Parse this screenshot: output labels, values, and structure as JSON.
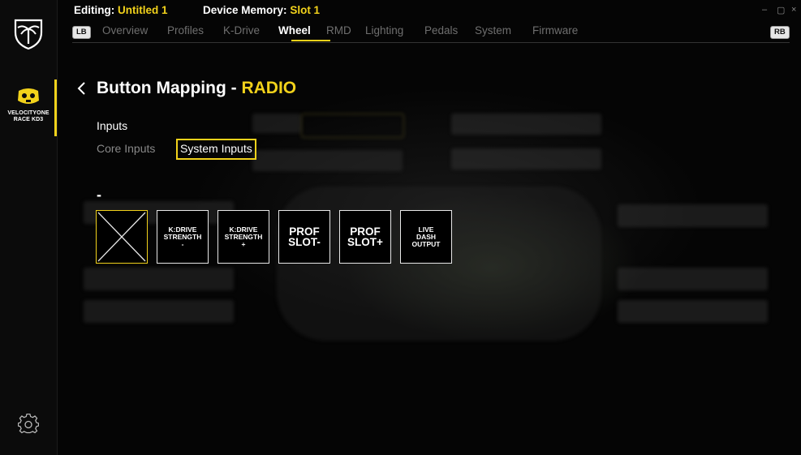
{
  "header": {
    "editing_label": "Editing:",
    "editing_value": "Untitled 1",
    "memory_label": "Device Memory:",
    "memory_value": "Slot 1"
  },
  "window_controls": [
    "–",
    "▢",
    "×"
  ],
  "tabs": {
    "left_key": "LB",
    "right_key": "RB",
    "items": [
      "Overview",
      "Profiles",
      "K-Drive",
      "Wheel",
      "RMD",
      "Lighting",
      "Pedals",
      "System",
      "Firmware"
    ],
    "active": "Wheel"
  },
  "sidebar": {
    "device_name_line1": "VELOCITYONE",
    "device_name_line2": "RACE KD3"
  },
  "page": {
    "title_prefix": "Button Mapping - ",
    "title_accent": "RADIO",
    "section_label": "Inputs",
    "subtab_core": "Core Inputs",
    "subtab_system": "System Inputs",
    "current_mapping": "-"
  },
  "tiles": [
    {
      "line1": "",
      "line2": "",
      "line3": "",
      "style": "empty"
    },
    {
      "line1": "K:DRIVE",
      "line2": "STRENGTH",
      "line3": "-",
      "style": "small"
    },
    {
      "line1": "K:DRIVE",
      "line2": "STRENGTH",
      "line3": "+",
      "style": "small"
    },
    {
      "line1": "PROF",
      "line2": "SLOT-",
      "line3": "",
      "style": "big"
    },
    {
      "line1": "PROF",
      "line2": "SLOT+",
      "line3": "",
      "style": "big"
    },
    {
      "line1": "LIVE",
      "line2": "DASH",
      "line3": "OUTPUT",
      "style": "small"
    }
  ],
  "colors": {
    "accent": "#f2d21b",
    "background": "#000000",
    "inactive_text": "#6f6f6f"
  }
}
